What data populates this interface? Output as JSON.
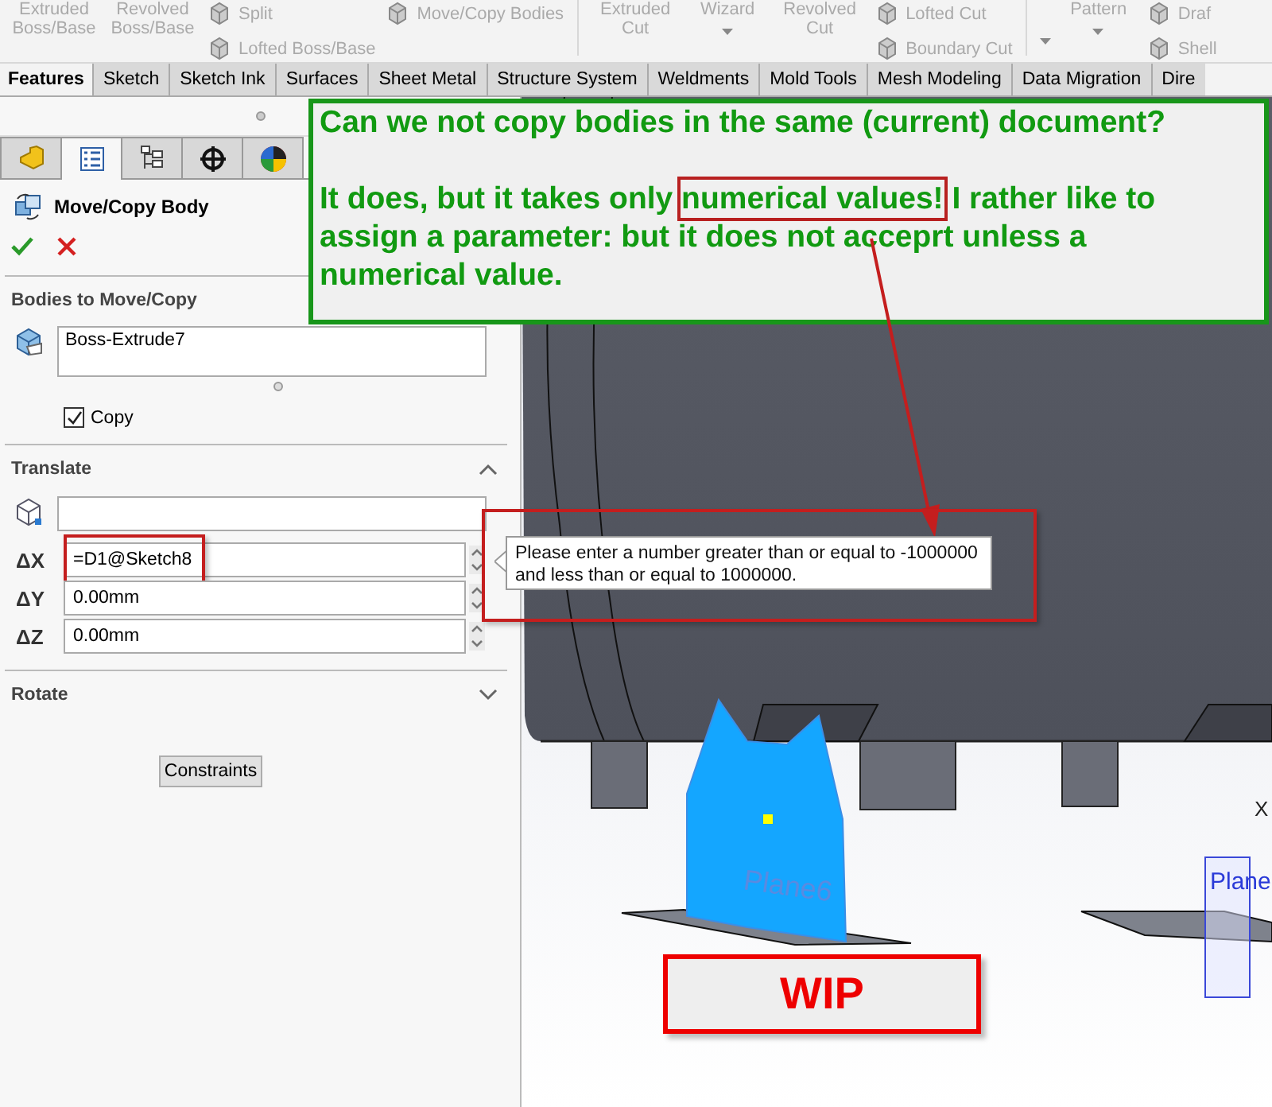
{
  "ribbon": {
    "groups": [
      [
        {
          "kind": "big",
          "label": "Extruded Boss/Base"
        },
        {
          "kind": "big",
          "label": "Revolved Boss/Base"
        },
        {
          "kind": "stack",
          "items": [
            "Split",
            "Lofted Boss/Base"
          ]
        },
        {
          "kind": "stack",
          "items": [
            "Move/Copy Bodies"
          ]
        }
      ],
      [
        {
          "kind": "big",
          "label": "Extruded Cut"
        },
        {
          "kind": "dropdown",
          "label": "Wizard"
        },
        {
          "kind": "big",
          "label": "Revolved Cut"
        },
        {
          "kind": "stack",
          "items": [
            "Lofted Cut",
            "Boundary Cut"
          ]
        }
      ],
      [
        {
          "kind": "caret"
        },
        {
          "kind": "dropdown",
          "label": "Pattern"
        },
        {
          "kind": "stack",
          "items": [
            "Draf",
            "Shell"
          ]
        }
      ]
    ]
  },
  "tabs": [
    {
      "label": "Features",
      "selected": true
    },
    {
      "label": "Sketch",
      "selected": false
    },
    {
      "label": "Sketch Ink",
      "selected": false
    },
    {
      "label": "Surfaces",
      "selected": false
    },
    {
      "label": "Sheet Metal",
      "selected": false
    },
    {
      "label": "Structure System",
      "selected": false
    },
    {
      "label": "Weldments",
      "selected": false
    },
    {
      "label": "Mold Tools",
      "selected": false
    },
    {
      "label": "Mesh Modeling",
      "selected": false
    },
    {
      "label": "Data Migration",
      "selected": false
    },
    {
      "label": "Dire",
      "selected": false
    }
  ],
  "panel": {
    "tabs": [
      {
        "kind": "part",
        "selected": false
      },
      {
        "kind": "properties",
        "selected": true
      },
      {
        "kind": "configurations",
        "selected": false
      },
      {
        "kind": "target",
        "selected": false
      },
      {
        "kind": "appearance",
        "selected": false
      }
    ],
    "title": "Move/Copy Body",
    "bodies": {
      "title": "Bodies to Move/Copy",
      "items": [
        "Boss-Extrude7"
      ],
      "copy": {
        "label": "Copy",
        "checked": true
      }
    },
    "translate": {
      "title": "Translate",
      "expanded": true,
      "deltas": [
        {
          "label": "ΔX",
          "value": "=D1@Sketch8",
          "highlighted": true
        },
        {
          "label": "ΔY",
          "value": "0.00mm",
          "highlighted": false
        },
        {
          "label": "ΔZ",
          "value": "0.00mm",
          "highlighted": false
        }
      ]
    },
    "rotate": {
      "title": "Rotate",
      "expanded": false
    },
    "button": "Constraints"
  },
  "tooltip": "Please enter a number greater than or equal to -1000000 and less than or equal to 1000000.",
  "viewport": {
    "labels": [
      "X",
      "Plane6",
      "Plane"
    ]
  },
  "annotation": {
    "question": "Can we not copy bodies in the same (current) document?",
    "answer_before": "It does, but it takes only ",
    "answer_highlight": "numerical values!",
    "answer_after": " I rather like to assign a parameter: but it does not acceprt unless a numerical value."
  },
  "stamp": "WIP"
}
